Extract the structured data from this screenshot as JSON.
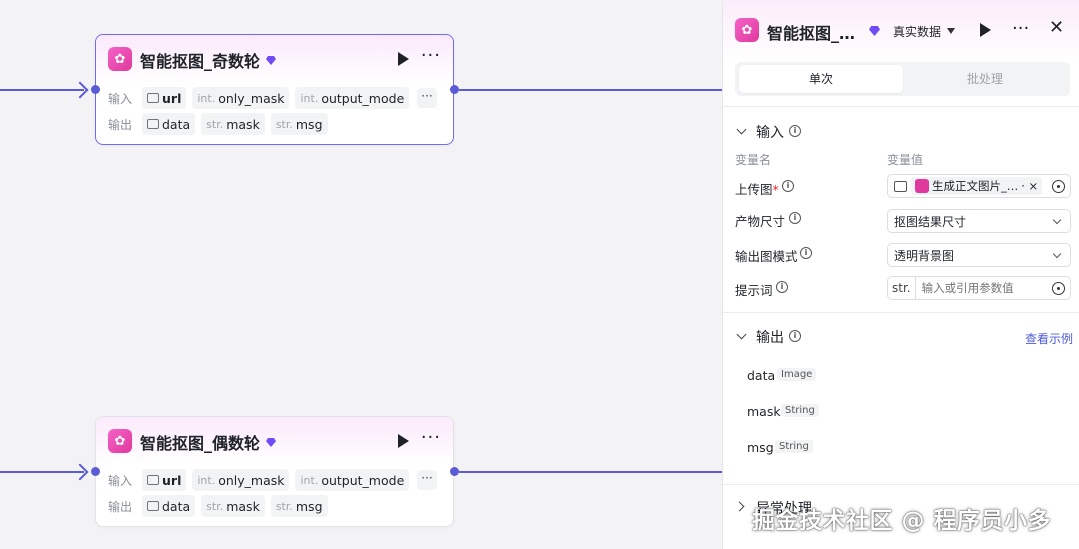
{
  "nodes": [
    {
      "title": "智能抠图_奇数轮",
      "input_label": "输入",
      "output_label": "输出",
      "inputs": [
        {
          "type": "",
          "name": "url"
        },
        {
          "type": "int.",
          "name": "only_mask"
        },
        {
          "type": "int.",
          "name": "output_mode"
        }
      ],
      "outputs": [
        {
          "type": "",
          "name": "data"
        },
        {
          "type": "str.",
          "name": "mask"
        },
        {
          "type": "str.",
          "name": "msg"
        }
      ],
      "more_glyph": "···",
      "chip_more_glyph": "···"
    },
    {
      "title": "智能抠图_偶数轮",
      "input_label": "输入",
      "output_label": "输出",
      "inputs": [
        {
          "type": "",
          "name": "url"
        },
        {
          "type": "int.",
          "name": "only_mask"
        },
        {
          "type": "int.",
          "name": "output_mode"
        }
      ],
      "outputs": [
        {
          "type": "",
          "name": "data"
        },
        {
          "type": "str.",
          "name": "mask"
        },
        {
          "type": "str.",
          "name": "msg"
        }
      ],
      "more_glyph": "···",
      "chip_more_glyph": "···"
    }
  ],
  "panel": {
    "title": "智能抠图_…",
    "mode": "真实数据",
    "more_glyph": "···",
    "close_glyph": "✕",
    "tabs": {
      "single": "单次",
      "batch": "批处理"
    },
    "input_section": {
      "title": "输入",
      "col_name": "变量名",
      "col_value": "变量值",
      "fields": [
        {
          "label": "上传图",
          "required": "*",
          "value_chip": "生成正文图片_…",
          "chip_suffix": "· ×"
        },
        {
          "label": "产物尺寸",
          "value": "抠图结果尺寸"
        },
        {
          "label": "输出图模式",
          "value": "透明背景图"
        },
        {
          "label": "提示词",
          "type": "str.",
          "placeholder": "输入或引用参数值"
        }
      ]
    },
    "output_section": {
      "title": "输出",
      "example_link": "查看示例",
      "items": [
        {
          "name": "data",
          "type": "Image"
        },
        {
          "name": "mask",
          "type": "String"
        },
        {
          "name": "msg",
          "type": "String"
        }
      ]
    },
    "exception_section": {
      "title": "异常处理"
    }
  },
  "watermark": "掘金技术社区 @ 程序员小多",
  "colors": {
    "edge": "#5b5bd6",
    "accent": "#6f4cf5",
    "link": "#4e5bd8",
    "node_icon": "#e0389c"
  }
}
